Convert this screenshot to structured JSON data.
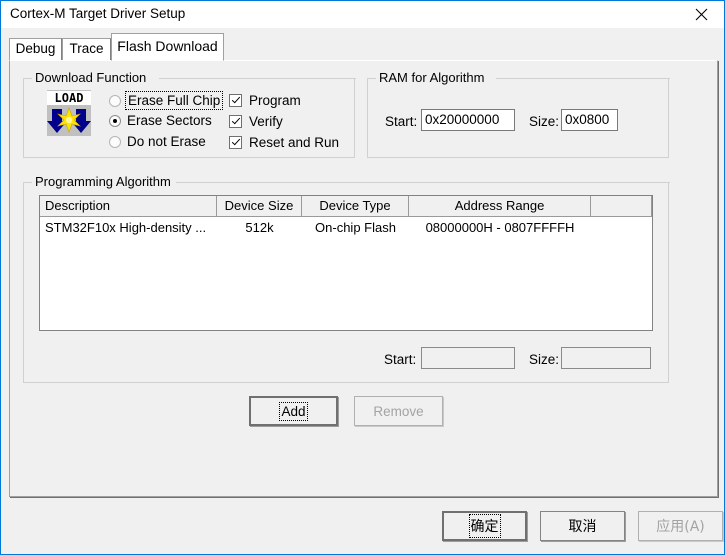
{
  "window": {
    "title": "Cortex-M Target Driver Setup",
    "close_icon": "close-icon",
    "accent_color": "#0078d7",
    "face_color": "#f0f0f0"
  },
  "tabs": [
    {
      "label": "Debug",
      "active": false
    },
    {
      "label": "Trace",
      "active": false
    },
    {
      "label": "Flash Download",
      "active": true
    }
  ],
  "download_function": {
    "legend": "Download Function",
    "icon": {
      "name": "load-icon",
      "text": "LOAD"
    },
    "erase_options": [
      {
        "label": "Erase Full Chip",
        "selected": false,
        "focused": true
      },
      {
        "label": "Erase Sectors",
        "selected": true,
        "focused": false
      },
      {
        "label": "Do not Erase",
        "selected": false,
        "focused": false
      }
    ],
    "flags": [
      {
        "label": "Program",
        "checked": true
      },
      {
        "label": "Verify",
        "checked": true
      },
      {
        "label": "Reset and Run",
        "checked": true
      }
    ]
  },
  "ram_for_algorithm": {
    "legend": "RAM for Algorithm",
    "start_label": "Start:",
    "start_value": "0x20000000",
    "size_label": "Size:",
    "size_value": "0x0800"
  },
  "programming_algorithm": {
    "legend": "Programming Algorithm",
    "columns": [
      "Description",
      "Device Size",
      "Device Type",
      "Address Range",
      ""
    ],
    "rows": [
      {
        "description": "STM32F10x High-density ...",
        "device_size": "512k",
        "device_type": "On-chip Flash",
        "address_range": "08000000H - 0807FFFFH",
        "extra": ""
      }
    ],
    "start_label": "Start:",
    "start_value": "",
    "size_label": "Size:",
    "size_value": ""
  },
  "algorithm_buttons": {
    "add": {
      "label": "Add",
      "enabled": true,
      "default": true
    },
    "remove": {
      "label": "Remove",
      "enabled": false
    }
  },
  "dialog_buttons": {
    "ok": {
      "label": "确定",
      "enabled": true,
      "default": true
    },
    "cancel": {
      "label": "取消",
      "enabled": true
    },
    "apply": {
      "label": "应用(A)",
      "enabled": false
    }
  }
}
